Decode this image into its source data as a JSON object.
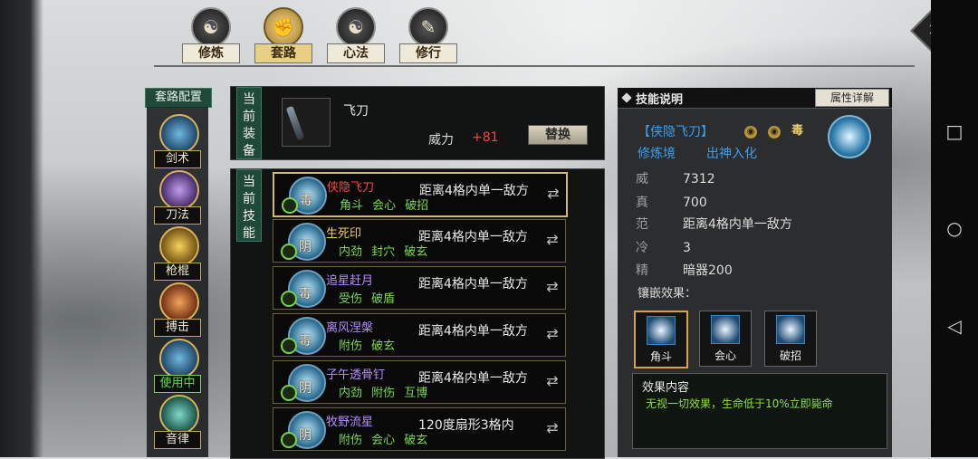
{
  "nav": {
    "tabs": [
      {
        "label": "修炼",
        "glyph": "☯"
      },
      {
        "label": "套路",
        "glyph": "✊",
        "active": true
      },
      {
        "label": "心法",
        "glyph": "☯"
      },
      {
        "label": "修行",
        "glyph": "✎"
      }
    ]
  },
  "category": {
    "header": "套路配置",
    "items": [
      {
        "label": "剑术"
      },
      {
        "label": "刀法"
      },
      {
        "label": "枪棍"
      },
      {
        "label": "搏击"
      },
      {
        "label": "使用中",
        "using": true
      },
      {
        "label": "音律"
      }
    ]
  },
  "equip": {
    "tag": "当前装备",
    "name": "飞刀",
    "power_label": "威力",
    "power_value": "+81",
    "replace_label": "替换"
  },
  "skills": {
    "tag": "当前技能",
    "list": [
      {
        "name": "侠隐飞刀",
        "name_color": "#ff4545",
        "badge": "毒",
        "tags": "角斗 会心 破招",
        "range": "距离4格内单一敌方"
      },
      {
        "name": "生死印",
        "name_color": "#f2d04c",
        "badge": "阴",
        "tags": "内劲 封穴 破玄",
        "range": "距离4格内单一敌方"
      },
      {
        "name": "追星赶月",
        "name_color": "#b38bff",
        "badge": "毒",
        "tags": "受伤 破盾",
        "range": "距离4格内单一敌方"
      },
      {
        "name": "离风涅槃",
        "name_color": "#b38bff",
        "badge": "毒",
        "tags": "附伤 破玄",
        "range": "距离4格内单一敌方"
      },
      {
        "name": "子午透骨钉",
        "name_color": "#b38bff",
        "badge": "阴",
        "tags": "内劲 附伤 互博",
        "range": "距离4格内单一敌方"
      },
      {
        "name": "牧野流星",
        "name_color": "#b38bff",
        "badge": "阴",
        "tags": "附伤 会心 破玄",
        "range": "120度扇形3格内"
      }
    ]
  },
  "detail": {
    "title": "技能说明",
    "attr_button": "属性详解",
    "skill_name": "【侠隐飞刀】",
    "cond_badge": "毒",
    "realm_label": "修炼境",
    "realm_value": "出神入化",
    "stats": [
      {
        "k": "威",
        "v": "7312"
      },
      {
        "k": "真",
        "v": "700"
      },
      {
        "k": "范",
        "v": "距离4格内单一敌方"
      },
      {
        "k": "冷",
        "v": "3"
      },
      {
        "k": "精",
        "v": "暗器200"
      }
    ],
    "inlay_label": "镶嵌效果：",
    "inlays": [
      {
        "label": "角斗",
        "selected": true
      },
      {
        "label": "会心"
      },
      {
        "label": "破招"
      }
    ],
    "effect_title": "效果内容",
    "effect_text": "无视一切效果，生命低于10%立即毙命"
  }
}
